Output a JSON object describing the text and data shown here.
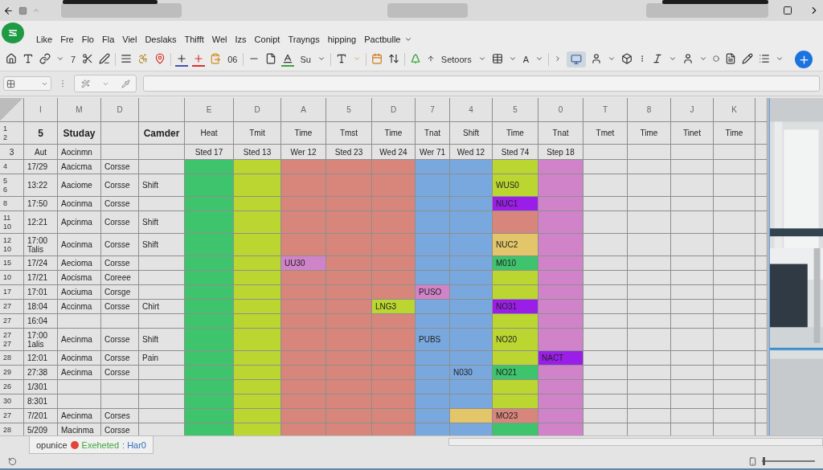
{
  "menu": [
    "Like",
    "Fre",
    "Flo",
    "Fla",
    "Viel",
    "Deslaks",
    "Thifft",
    "Wel",
    "Izs",
    "Conipt",
    "Trayngs",
    "hipping",
    "Pactbulle"
  ],
  "toolbar": {
    "labels": [
      "7",
      "06",
      "Su",
      "Setoors",
      "A"
    ],
    "toggle_selected": true
  },
  "columns": [
    {
      "kind": "plain",
      "letter": "I",
      "header": "5",
      "subheader": "Aut"
    },
    {
      "kind": "plain",
      "letter": "M",
      "header": "Studay",
      "subheader": "Aocinmn"
    },
    {
      "kind": "plain",
      "letter": "D"
    },
    {
      "kind": "plain",
      "header": "Camder"
    },
    {
      "kind": "band",
      "letter": "E",
      "header": "Heat",
      "subheader": "Sted 17"
    },
    {
      "kind": "band",
      "letter": "D",
      "header": "Tmit",
      "subheader": "Sted 13"
    },
    {
      "kind": "band",
      "letter": "A",
      "header": "Time",
      "subheader": "Wer 12"
    },
    {
      "kind": "band",
      "letter": "5",
      "header": "Tmst",
      "subheader": "Sted 23"
    },
    {
      "kind": "band",
      "letter": "D",
      "header": "Time",
      "subheader": "Wed 24"
    },
    {
      "kind": "band",
      "letter": "7",
      "header": "Tnat",
      "subheader": "Wer 71"
    },
    {
      "kind": "band",
      "letter": "4",
      "header": "Shift",
      "subheader": "Wed 12"
    },
    {
      "kind": "band",
      "letter": "5",
      "header": "Time",
      "subheader": "Sted 74"
    },
    {
      "kind": "band",
      "letter": "0",
      "header": "Tnat",
      "subheader": "Step 18"
    },
    {
      "kind": "plain",
      "letter": "T",
      "header": "Tmet"
    },
    {
      "kind": "plain",
      "letter": "8",
      "header": "Time"
    },
    {
      "kind": "plain",
      "letter": "J",
      "header": "Tinet"
    },
    {
      "kind": "plain",
      "letter": "K",
      "header": "Time"
    }
  ],
  "header_row_labels": [
    "1",
    "2"
  ],
  "subheader_row_label": "3",
  "rows": [
    {
      "labels": [
        "4"
      ],
      "cells": [
        "17/29",
        "Aacicma",
        "Corsse"
      ],
      "band": [
        {
          "color": "#3ec46d"
        },
        {
          "color": "#bcd631"
        },
        {
          "color": "#d8867b"
        },
        {
          "color": "#d8867b"
        },
        {
          "color": "#d8867b"
        },
        {
          "color": "#79a8de"
        },
        {
          "color": "#79a8de"
        },
        {
          "color": "#bcd631"
        },
        {
          "color": "#d183c9"
        }
      ]
    },
    {
      "labels": [
        "5",
        "6"
      ],
      "cells": [
        "13:22",
        "Aaciome",
        "Corsse",
        "Shift"
      ],
      "band": [
        {
          "color": "#3ec46d"
        },
        {
          "color": "#bcd631"
        },
        {
          "color": "#d8867b"
        },
        {
          "color": "#d8867b"
        },
        {
          "color": "#d8867b"
        },
        {
          "color": "#79a8de"
        },
        {
          "color": "#79a8de"
        },
        {
          "color": "#bcd631",
          "text": "WUS0"
        },
        {
          "color": "#d183c9"
        }
      ]
    },
    {
      "labels": [
        "8"
      ],
      "cells": [
        "17:50",
        "Aocinma",
        "Corsse"
      ],
      "band": [
        {
          "color": "#3ec46d"
        },
        {
          "color": "#bcd631"
        },
        {
          "color": "#d8867b"
        },
        {
          "color": "#d8867b"
        },
        {
          "color": "#d8867b"
        },
        {
          "color": "#79a8de"
        },
        {
          "color": "#79a8de"
        },
        {
          "color": "#9b1ee8",
          "text": "NUC1"
        },
        {
          "color": "#d183c9"
        }
      ]
    },
    {
      "labels": [
        "11",
        "10"
      ],
      "cells": [
        "12:21",
        "Apcinma",
        "Corsse",
        "Shift"
      ],
      "band": [
        {
          "color": "#3ec46d"
        },
        {
          "color": "#bcd631"
        },
        {
          "color": "#d8867b"
        },
        {
          "color": "#d8867b"
        },
        {
          "color": "#d8867b"
        },
        {
          "color": "#79a8de"
        },
        {
          "color": "#79a8de"
        },
        {
          "color": "#d8867b"
        },
        {
          "color": "#d183c9"
        }
      ]
    },
    {
      "labels": [
        "12",
        "10"
      ],
      "cells": [
        "17:00 Talis",
        "Aocinma",
        "Corsse",
        "Shift"
      ],
      "band": [
        {
          "color": "#3ec46d"
        },
        {
          "color": "#bcd631"
        },
        {
          "color": "#d8867b"
        },
        {
          "color": "#d8867b"
        },
        {
          "color": "#d8867b"
        },
        {
          "color": "#79a8de"
        },
        {
          "color": "#79a8de"
        },
        {
          "color": "#e3c56a",
          "text": "NUC2"
        },
        {
          "color": "#d183c9"
        }
      ]
    },
    {
      "labels": [
        "15"
      ],
      "cells": [
        "17/24",
        "Aecioma",
        "Corsse"
      ],
      "band": [
        {
          "color": "#3ec46d"
        },
        {
          "color": "#bcd631"
        },
        {
          "color": "#d183c9",
          "text": "UU30"
        },
        {
          "color": "#d8867b"
        },
        {
          "color": "#d8867b"
        },
        {
          "color": "#79a8de"
        },
        {
          "color": "#79a8de"
        },
        {
          "color": "#3ec46d",
          "text": "M010"
        },
        {
          "color": "#d183c9"
        }
      ]
    },
    {
      "labels": [
        "10"
      ],
      "cells": [
        "17/21",
        "Aocisma",
        "Coreee"
      ],
      "band": [
        {
          "color": "#3ec46d"
        },
        {
          "color": "#bcd631"
        },
        {
          "color": "#d8867b"
        },
        {
          "color": "#d8867b"
        },
        {
          "color": "#d8867b"
        },
        {
          "color": "#79a8de"
        },
        {
          "color": "#79a8de"
        },
        {
          "color": "#bcd631"
        },
        {
          "color": "#d183c9"
        }
      ]
    },
    {
      "labels": [
        "17"
      ],
      "cells": [
        "17:01",
        "Aociuma",
        "Corsge"
      ],
      "band": [
        {
          "color": "#3ec46d"
        },
        {
          "color": "#bcd631"
        },
        {
          "color": "#d8867b"
        },
        {
          "color": "#d8867b"
        },
        {
          "color": "#d8867b"
        },
        {
          "color": "#d183c9",
          "text": "PUSO"
        },
        {
          "color": "#79a8de"
        },
        {
          "color": "#bcd631"
        },
        {
          "color": "#d183c9"
        }
      ]
    },
    {
      "labels": [
        "27"
      ],
      "cells": [
        "18:04",
        "Accinma",
        "Corsse",
        "Chirt"
      ],
      "band": [
        {
          "color": "#3ec46d"
        },
        {
          "color": "#bcd631"
        },
        {
          "color": "#d8867b"
        },
        {
          "color": "#d8867b"
        },
        {
          "color": "#bcd631",
          "text": "LNG3"
        },
        {
          "color": "#79a8de"
        },
        {
          "color": "#79a8de"
        },
        {
          "color": "#9b1ee8",
          "text": "NO31"
        },
        {
          "color": "#d183c9"
        }
      ]
    },
    {
      "labels": [
        "27"
      ],
      "cells": [
        "16:04"
      ],
      "band": [
        {
          "color": "#3ec46d"
        },
        {
          "color": "#bcd631"
        },
        {
          "color": "#d8867b"
        },
        {
          "color": "#d8867b"
        },
        {
          "color": "#d8867b"
        },
        {
          "color": "#79a8de"
        },
        {
          "color": "#79a8de"
        },
        {
          "color": "#bcd631"
        },
        {
          "color": "#d183c9"
        }
      ]
    },
    {
      "labels": [
        "27",
        "27"
      ],
      "cells": [
        "17:00 1alis",
        "Aecinma",
        "Corsse",
        "Shift"
      ],
      "band": [
        {
          "color": "#3ec46d"
        },
        {
          "color": "#bcd631"
        },
        {
          "color": "#d8867b"
        },
        {
          "color": "#d8867b"
        },
        {
          "color": "#d8867b"
        },
        {
          "color": "#79a8de",
          "text": "PUBS"
        },
        {
          "color": "#79a8de"
        },
        {
          "color": "#bcd631",
          "text": "NO20"
        },
        {
          "color": "#d183c9"
        }
      ]
    },
    {
      "labels": [
        "28"
      ],
      "cells": [
        "12:01",
        "Aocinma",
        "Corsse",
        "Pain"
      ],
      "band": [
        {
          "color": "#3ec46d"
        },
        {
          "color": "#bcd631"
        },
        {
          "color": "#d8867b"
        },
        {
          "color": "#d8867b"
        },
        {
          "color": "#d8867b"
        },
        {
          "color": "#79a8de"
        },
        {
          "color": "#79a8de"
        },
        {
          "color": "#bcd631"
        },
        {
          "color": "#9b1ee8",
          "text": "NACT"
        }
      ]
    },
    {
      "labels": [
        "29"
      ],
      "cells": [
        "27:38",
        "Aecinma",
        "Corsse"
      ],
      "band": [
        {
          "color": "#3ec46d"
        },
        {
          "color": "#bcd631"
        },
        {
          "color": "#d8867b"
        },
        {
          "color": "#d8867b"
        },
        {
          "color": "#d8867b"
        },
        {
          "color": "#79a8de"
        },
        {
          "color": "#79a8de",
          "text": "N030"
        },
        {
          "color": "#3ec46d",
          "text": "NO21"
        },
        {
          "color": "#d183c9"
        }
      ]
    },
    {
      "labels": [
        "26"
      ],
      "cells": [
        "1/301"
      ],
      "band": [
        {
          "color": "#3ec46d"
        },
        {
          "color": "#bcd631"
        },
        {
          "color": "#d8867b"
        },
        {
          "color": "#d8867b"
        },
        {
          "color": "#d8867b"
        },
        {
          "color": "#79a8de"
        },
        {
          "color": "#79a8de"
        },
        {
          "color": "#bcd631"
        },
        {
          "color": "#d183c9"
        }
      ]
    },
    {
      "labels": [
        "30"
      ],
      "cells": [
        "8:301"
      ],
      "band": [
        {
          "color": "#3ec46d"
        },
        {
          "color": "#bcd631"
        },
        {
          "color": "#d8867b"
        },
        {
          "color": "#d8867b"
        },
        {
          "color": "#d8867b"
        },
        {
          "color": "#79a8de"
        },
        {
          "color": "#79a8de"
        },
        {
          "color": "#bcd631"
        },
        {
          "color": "#d183c9"
        }
      ]
    },
    {
      "labels": [
        "27"
      ],
      "cells": [
        "7/201",
        "Aecinma",
        "Corses"
      ],
      "band": [
        {
          "color": "#3ec46d"
        },
        {
          "color": "#bcd631"
        },
        {
          "color": "#d8867b"
        },
        {
          "color": "#d8867b"
        },
        {
          "color": "#d8867b"
        },
        {
          "color": "#79a8de"
        },
        {
          "color": "#e3c56a"
        },
        {
          "color": "#d8867b",
          "text": "MO23"
        },
        {
          "color": "#d183c9"
        }
      ]
    },
    {
      "labels": [
        "28"
      ],
      "cells": [
        "5/209",
        "Macinma",
        "Corsse"
      ],
      "band": [
        {
          "color": "#3ec46d"
        },
        {
          "color": "#bcd631"
        },
        {
          "color": "#d8867b"
        },
        {
          "color": "#d8867b"
        },
        {
          "color": "#d8867b"
        },
        {
          "color": "#79a8de"
        },
        {
          "color": "#79a8de"
        },
        {
          "color": "#3ec46d"
        },
        {
          "color": "#d183c9"
        }
      ]
    }
  ],
  "sheet_tab": {
    "name": "opunice",
    "status": "Exeheted",
    "detail": ": Har0"
  },
  "zoom": {
    "level": 0.02
  }
}
